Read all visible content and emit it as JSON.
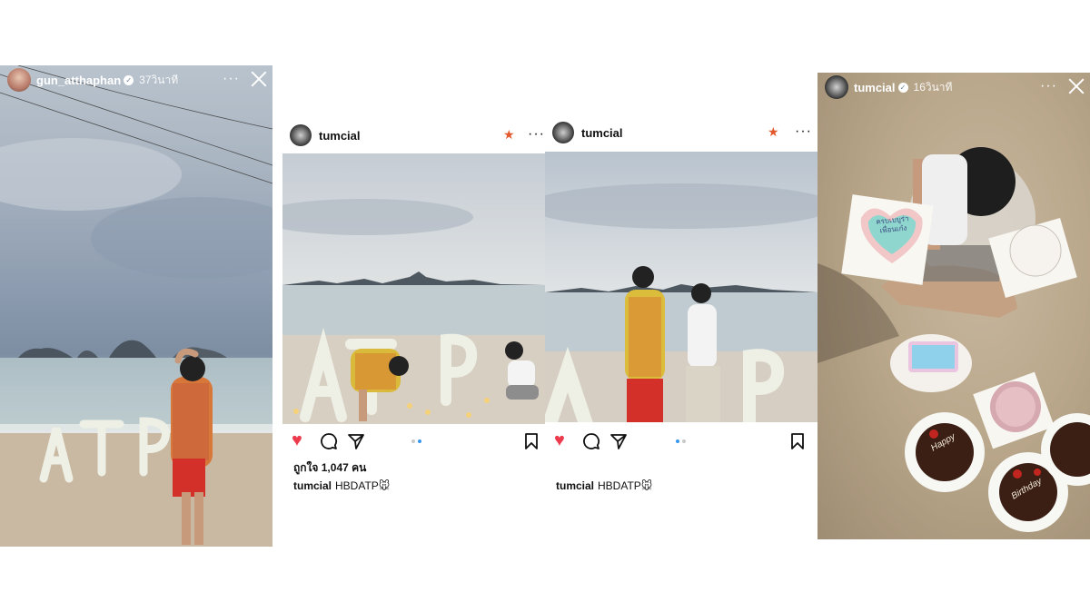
{
  "story_left": {
    "username": "gun_atthaphan",
    "time": "37วินาที",
    "letters": [
      "A",
      "T",
      "P"
    ]
  },
  "post_left": {
    "username": "tumcial",
    "likes": "ถูกใจ 1,047 คน",
    "caption_user": "tumcial",
    "caption_text": "HBDATP🐭"
  },
  "post_right": {
    "username": "tumcial",
    "caption_user": "tumcial",
    "caption_text": "HBDATP🐭"
  },
  "story_right": {
    "username": "tumcial",
    "time": "16วินาที",
    "cake_texts": [
      "ครบเบบูร่าเพื่อนเก๋ง",
      "Happy",
      "Birthday"
    ]
  },
  "icons": {
    "like": "heart-icon",
    "comment": "comment-icon",
    "share": "share-icon",
    "save": "bookmark-icon",
    "favorite": "star-icon",
    "more": "more-icon",
    "close": "close-icon",
    "verified": "verified-badge-icon"
  },
  "colors": {
    "heart": "#ed3b4e",
    "star": "#e2572b",
    "carousel_active": "#3897f0"
  }
}
